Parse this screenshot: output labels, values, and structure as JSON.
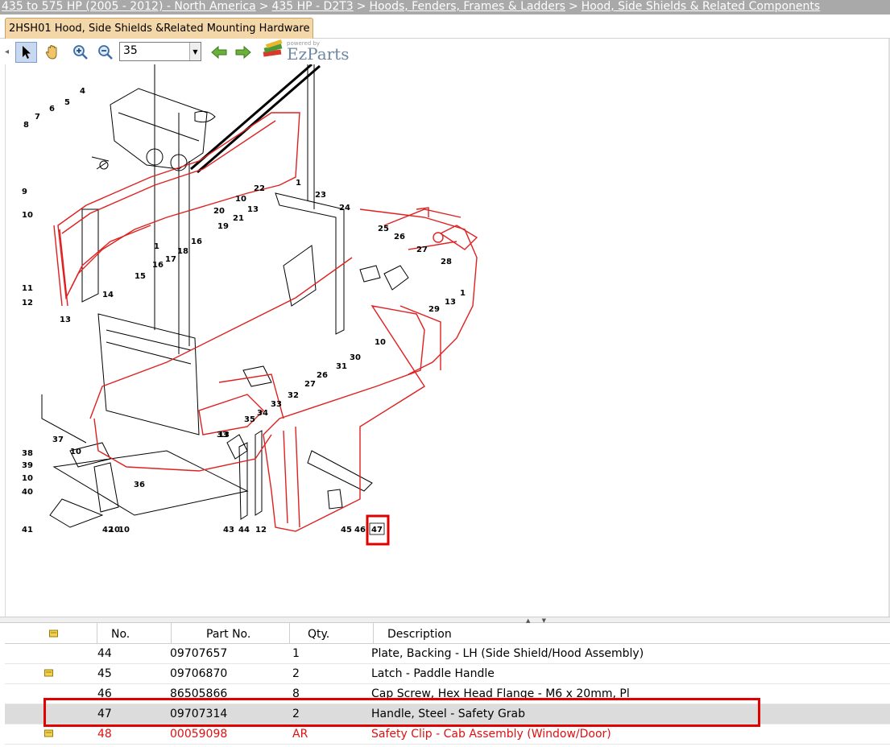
{
  "breadcrumb": {
    "items": [
      "435 to 575 HP (2005 - 2012) - North America",
      "435 HP - D2T3",
      "Hoods, Fenders, Frames & Ladders",
      "Hood, Side Shields & Related Components"
    ],
    "separator": ">"
  },
  "tab": {
    "label": "2HSH01 Hood, Side Shields &Related Mounting Hardware"
  },
  "toolbar": {
    "tools": [
      "pointer-icon",
      "hand-pan-icon",
      "zoom-in-icon",
      "zoom-out-icon",
      "arrow-left-icon",
      "arrow-right-icon"
    ],
    "zoom_value": "35",
    "brand_powered": "powered by",
    "brand_name": "EzParts"
  },
  "diagram": {
    "callouts": [
      "1",
      "1",
      "1",
      "4",
      "5",
      "6",
      "7",
      "8",
      "9",
      "10",
      "10",
      "10",
      "10",
      "10",
      "10",
      "10",
      "11",
      "12",
      "12",
      "13",
      "13",
      "13",
      "13",
      "14",
      "15",
      "16",
      "16",
      "17",
      "18",
      "19",
      "20",
      "21",
      "22",
      "23",
      "24",
      "25",
      "26",
      "26",
      "27",
      "27",
      "28",
      "29",
      "30",
      "31",
      "32",
      "33",
      "33",
      "34",
      "35",
      "36",
      "37",
      "38",
      "39",
      "40",
      "41",
      "42",
      "43",
      "44",
      "45",
      "46",
      "47"
    ],
    "highlighted_callout": "47",
    "line_color": "#e02020"
  },
  "table": {
    "columns": [
      "",
      "No.",
      "Part No.",
      "Qty.",
      "Description"
    ],
    "rows": [
      {
        "note": false,
        "no": "44",
        "part": "09707657",
        "qty": "1",
        "desc": "Plate, Backing - LH (Side Shield/Hood Assembly)"
      },
      {
        "note": true,
        "no": "45",
        "part": "09706870",
        "qty": "2",
        "desc": "Latch - Paddle Handle"
      },
      {
        "note": false,
        "no": "46",
        "part": "86505866",
        "qty": "8",
        "desc": "Cap Screw, Hex Head Flange - M6 x 20mm, Pl"
      },
      {
        "note": false,
        "no": "47",
        "part": "09707314",
        "qty": "2",
        "desc": "Handle, Steel - Safety Grab"
      },
      {
        "note": true,
        "no": "48",
        "part": "00059098",
        "qty": "AR",
        "desc": "Safety Clip - Cab Assembly (Window/Door)"
      }
    ],
    "selected_row": "47",
    "highlight_color": "#e00000"
  }
}
